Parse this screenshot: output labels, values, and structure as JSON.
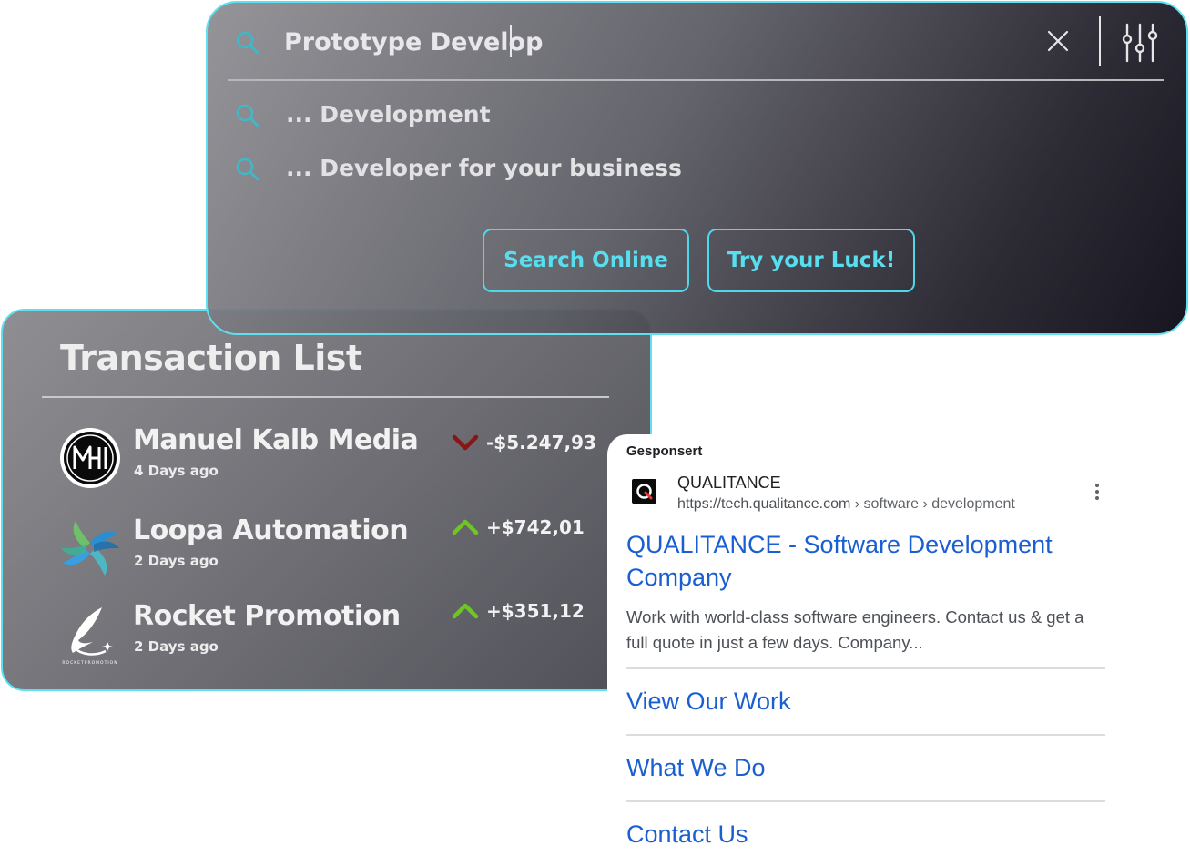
{
  "transactions": {
    "title": "Transaction List",
    "items": [
      {
        "name": "Manuel Kalb Media",
        "date": "4 Days ago",
        "amount": "-$5.247,93",
        "direction": "down",
        "logo_icon": "mk-monogram-logo"
      },
      {
        "name": "Loopa Automation",
        "date": "2 Days ago",
        "amount": "+$742,01",
        "direction": "up",
        "logo_icon": "loopa-swirl-logo"
      },
      {
        "name": "Rocket Promotion",
        "date": "2 Days ago",
        "amount": "+$351,12",
        "direction": "up",
        "logo_icon": "rocket-promotion-logo"
      }
    ],
    "colors": {
      "down": "#8b1414",
      "up": "#6fc524",
      "border": "#5ee0f0"
    }
  },
  "search": {
    "query": "Prototype Develop",
    "suggestions": [
      {
        "label": "... Development"
      },
      {
        "label": "... Developer for your business"
      }
    ],
    "buttons": {
      "online": "Search Online",
      "luck": "Try your Luck!"
    },
    "icons": [
      "search-icon",
      "close-icon",
      "sliders-icon"
    ],
    "accent": "#4fd7ea"
  },
  "ad": {
    "sponsored_label": "Gesponsert",
    "site_name": "QUALITANCE",
    "url": "https://tech.qualitance.com",
    "url_path": " › software › development",
    "headline": "QUALITANCE - Software Development Company",
    "description": "Work with world-class software engineers. Contact us & get a full quote in just a few days. Company...",
    "links": [
      "View Our Work",
      "What We Do",
      "Contact Us"
    ],
    "link_color": "#1a5fd1"
  },
  "rocket_logo_caption": "ROCKETPROMOTION"
}
